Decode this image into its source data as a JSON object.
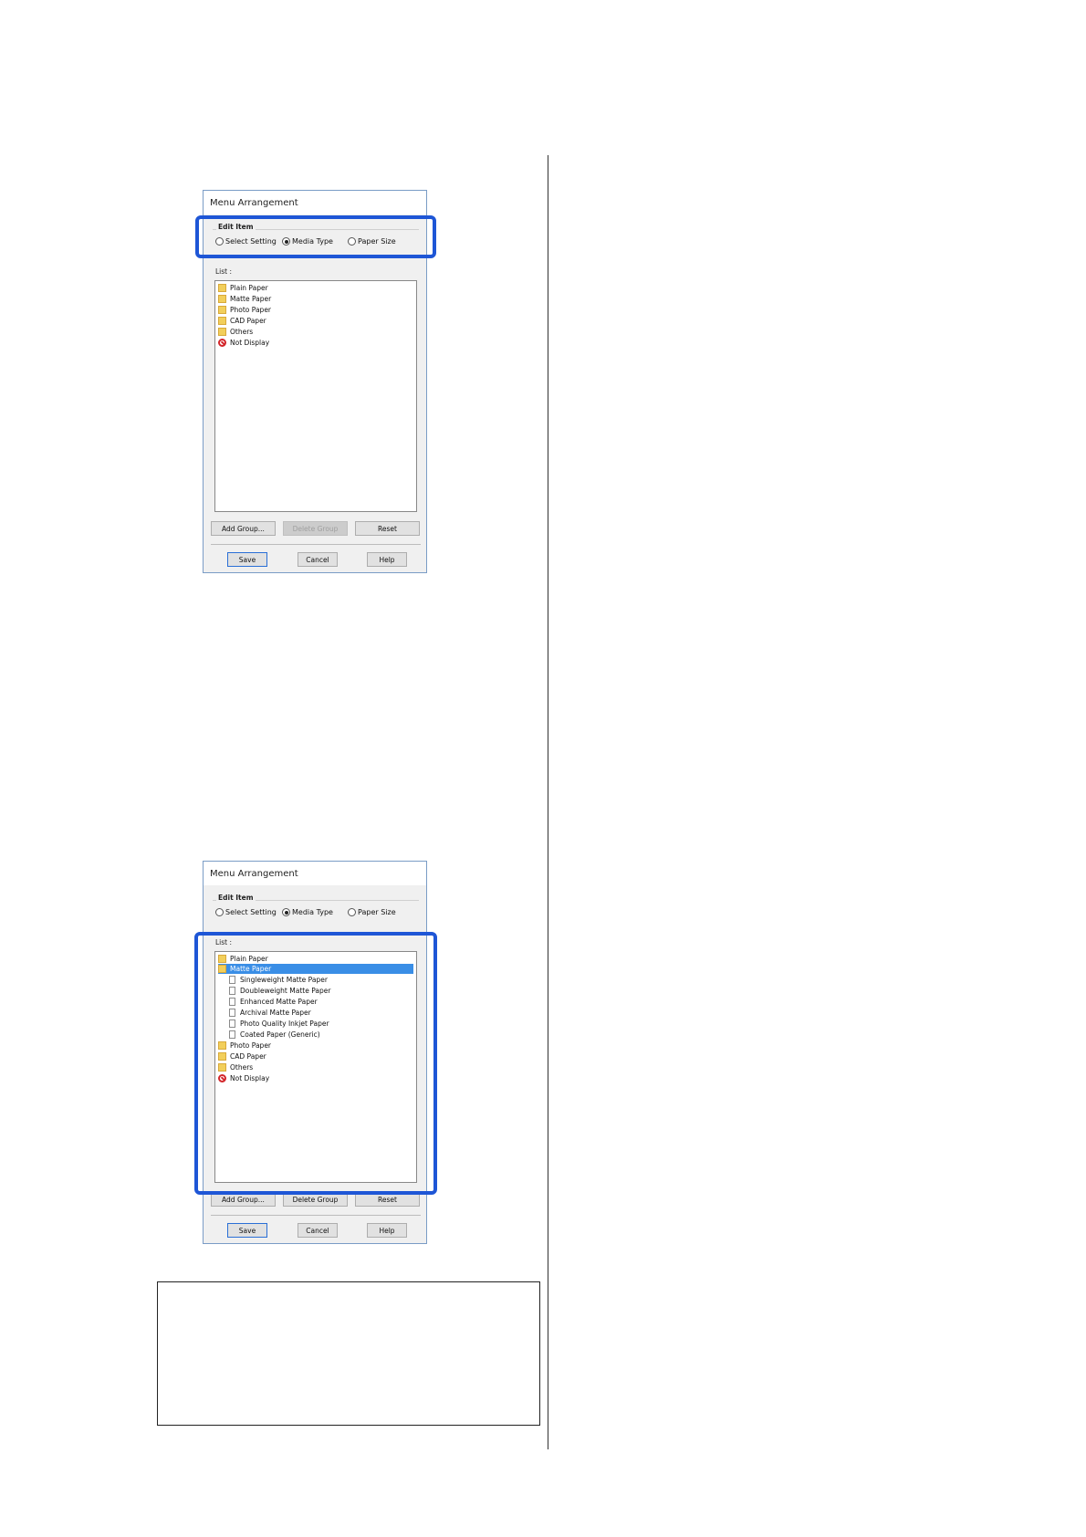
{
  "dialog1": {
    "title": "Menu Arrangement",
    "edit_item_legend": "Edit Item",
    "radios": [
      "Select Setting",
      "Media Type",
      "Paper Size"
    ],
    "selected_radio": "Media Type",
    "list_label": "List :",
    "list_items": [
      {
        "label": "Plain Paper",
        "icon": "folder-icon"
      },
      {
        "label": "Matte Paper",
        "icon": "folder-icon"
      },
      {
        "label": "Photo Paper",
        "icon": "folder-icon"
      },
      {
        "label": "CAD Paper",
        "icon": "folder-icon"
      },
      {
        "label": "Others",
        "icon": "folder-icon"
      },
      {
        "label": "Not Display",
        "icon": "no-entry-icon"
      }
    ],
    "buttons": {
      "add_group": "Add Group...",
      "delete_group": "Delete Group",
      "reset": "Reset",
      "save": "Save",
      "cancel": "Cancel",
      "help": "Help"
    },
    "delete_group_enabled": false
  },
  "dialog2": {
    "title": "Menu Arrangement",
    "edit_item_legend": "Edit Item",
    "radios": [
      "Select Setting",
      "Media Type",
      "Paper Size"
    ],
    "selected_radio": "Media Type",
    "list_label": "List :",
    "list_items": [
      {
        "label": "Plain Paper",
        "icon": "folder-icon"
      },
      {
        "label": "Matte Paper",
        "icon": "folder-icon",
        "selected": true
      },
      {
        "label": "Singleweight Matte Paper",
        "icon": "page-icon"
      },
      {
        "label": "Doubleweight Matte Paper",
        "icon": "page-icon"
      },
      {
        "label": "Enhanced Matte Paper",
        "icon": "page-icon"
      },
      {
        "label": "Archival Matte Paper",
        "icon": "page-icon"
      },
      {
        "label": "Photo Quality Inkjet Paper",
        "icon": "page-icon"
      },
      {
        "label": "Coated Paper (Generic)",
        "icon": "page-icon"
      },
      {
        "label": "Photo Paper",
        "icon": "folder-icon"
      },
      {
        "label": "CAD Paper",
        "icon": "folder-icon"
      },
      {
        "label": "Others",
        "icon": "folder-icon"
      },
      {
        "label": "Not Display",
        "icon": "no-entry-icon"
      }
    ],
    "buttons": {
      "add_group": "Add Group...",
      "delete_group": "Delete Group",
      "reset": "Reset",
      "save": "Save",
      "cancel": "Cancel",
      "help": "Help"
    },
    "delete_group_enabled": true
  },
  "colors": {
    "highlight": "#1e56d6",
    "selection": "#3a8ee6",
    "folder": "#f2cf5b",
    "no_display": "#d3262a"
  }
}
